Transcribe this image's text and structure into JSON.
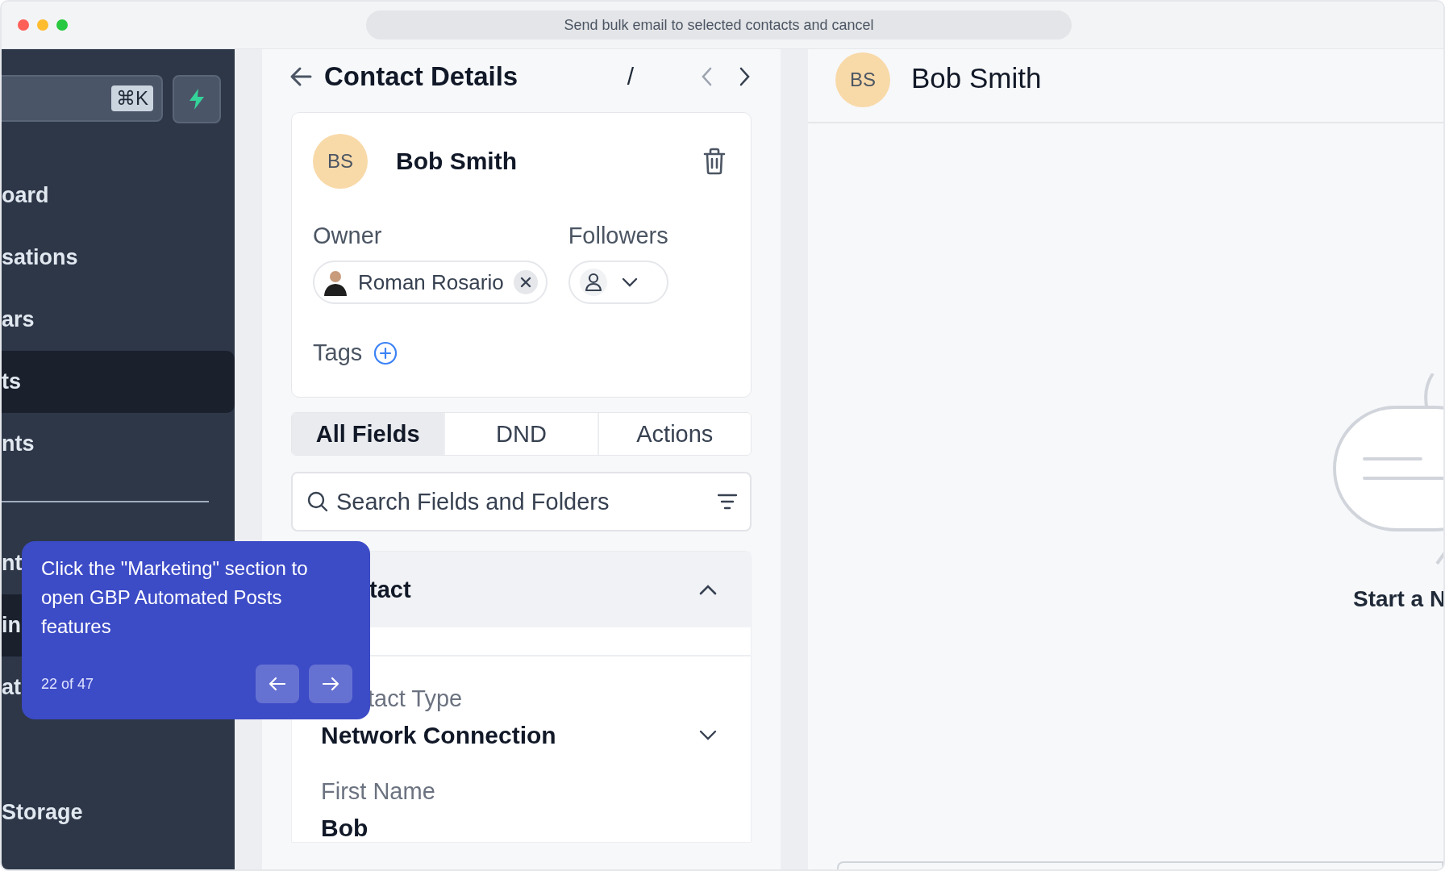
{
  "window": {
    "title": "Send bulk email to selected contacts and cancel"
  },
  "sidebar": {
    "search": {
      "shortcut": "⌘K"
    },
    "items": [
      {
        "label": "oard",
        "selected": false
      },
      {
        "label": "sations",
        "selected": false
      },
      {
        "label": "ars",
        "selected": false
      },
      {
        "label": "ts",
        "selected": true
      },
      {
        "label": "nts",
        "selected": false
      }
    ],
    "items_2": [
      {
        "label": "nt",
        "selected": false
      },
      {
        "label": "in",
        "selected": true
      },
      {
        "label": "at",
        "selected": false
      },
      {
        "label": "Storage",
        "selected": false
      }
    ]
  },
  "contact": {
    "title": "Contact Details",
    "pager": "/",
    "initials": "BS",
    "name": "Bob Smith",
    "owner_label": "Owner",
    "owner": "Roman Rosario",
    "followers_label": "Followers",
    "tags_label": "Tags"
  },
  "tabs": [
    {
      "label": "All Fields",
      "selected": true
    },
    {
      "label": "DND",
      "selected": false
    },
    {
      "label": "Actions",
      "selected": false
    }
  ],
  "search": {
    "placeholder": "Search Fields and Folders"
  },
  "section": {
    "title": "tact",
    "expanded": true,
    "fields": [
      {
        "kind": "select",
        "label": "tact Type",
        "value": "Network Connection"
      },
      {
        "kind": "text",
        "label": "First Name",
        "value": "Bob"
      }
    ]
  },
  "conversation": {
    "initials": "BS",
    "name": "Bob Smith",
    "empty_title": "Start a N"
  },
  "tour": {
    "text": "Click the \"Marketing\" section to open GBP Automated Posts features",
    "progress": "22 of 47"
  }
}
